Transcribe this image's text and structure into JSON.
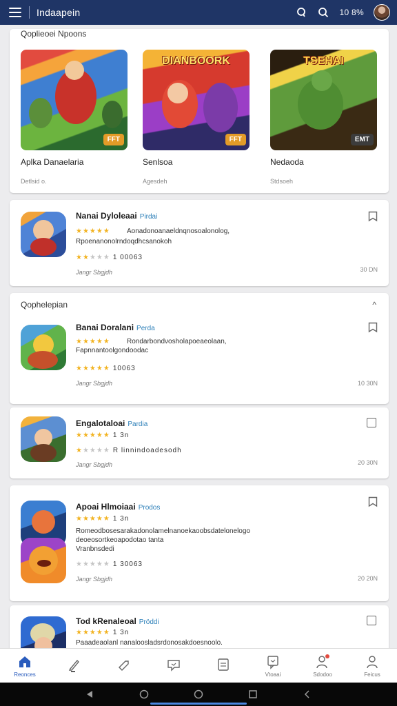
{
  "topbar": {
    "title": "Indaapein",
    "status": "10 8%"
  },
  "featured": {
    "header": "Qoplieoei Npoons",
    "items": [
      {
        "name": "Aplka Danaelaria",
        "sub": "Detlsid o.",
        "badge": "FFT",
        "art_title": ""
      },
      {
        "name": "Senlsoa",
        "sub": "Agesdeh",
        "badge": "FFT",
        "art_title": "DIANBOORK"
      },
      {
        "name": "Nedaoda",
        "sub": "Stdsoeh",
        "badge": "EMT",
        "art_title": "TSEHAI"
      }
    ]
  },
  "apps": [
    {
      "name": "Nanai Dyloleaai",
      "tag": "Pirdai",
      "line1": "Aonadonoanaeldnqnosoalonolog,",
      "line2": "Rpoenanonolrndoqdhcsanokoh",
      "rating_note": "1 00063",
      "stars_full": 2,
      "top_stars_full": 5,
      "meta": "Jangr Sbgjdh",
      "size": "30 DN"
    },
    {
      "name": "Banai Doralani",
      "tag": "Perda",
      "line1": "Rondarbondvosholapoeaeolaan,",
      "line2": "Fapnnantoolgondoodac",
      "rating_note": "10063",
      "stars_full": 5,
      "top_stars_full": 5,
      "meta": "Jangr Sbgjdh",
      "size": "10 30N",
      "section": "Qophelepian",
      "collapse": "^"
    },
    {
      "name": "Engalotaloai",
      "tag": "Pardia",
      "rating_note": "1 3n",
      "line2": "R linnindoadesodh",
      "stars_full": 1,
      "top_stars_full": 5,
      "meta": "Jangr Sbgjdh",
      "size": "20 30N"
    },
    {
      "name": "Apoai Hlmoiaai",
      "tag": "Prodos",
      "rating_note": "1 3n",
      "line1": "Romeodbosesarakadonolamelnanoekaoobsdatelonelogo",
      "line1b": "deoeosortkeoapodotao tanta",
      "line2": "Vranbnsdedi",
      "rating2": "1 30063",
      "stars_full": 0,
      "top_stars_full": 5,
      "meta": "Jangr Sbgjdh",
      "size": "20 20N"
    },
    {
      "name": "Tod kRenaleoal",
      "tag": "Pröddi",
      "rating_note": "1 3n",
      "line1": "Paaadeaolanl nanaloosladsrdonosakdoesnoolo.",
      "top_stars_full": 5
    }
  ],
  "bottomnav": [
    {
      "label": "Reonces",
      "icon": "home-icon",
      "active": true
    },
    {
      "label": "",
      "icon": "pen-icon"
    },
    {
      "label": "",
      "icon": "tag-icon"
    },
    {
      "label": "",
      "icon": "chat-bubble-icon"
    },
    {
      "label": "",
      "icon": "document-icon"
    },
    {
      "label": "Vtoaai",
      "icon": "message-icon"
    },
    {
      "label": "Sdodoo",
      "icon": "profile-badge-icon"
    },
    {
      "label": "Feicus",
      "icon": "user-icon"
    }
  ],
  "colors": {
    "topbar": "#1f3566",
    "accent": "#2a5cbd",
    "star": "#f2b321",
    "tag": "#2c7fb8"
  }
}
